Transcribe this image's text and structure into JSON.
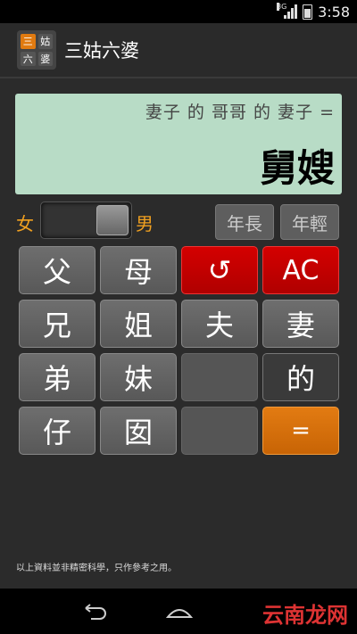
{
  "status_bar": {
    "network": "3G",
    "time": "3:58"
  },
  "app": {
    "title": "三姑六婆",
    "logo": [
      "三",
      "姑",
      "六",
      "婆"
    ]
  },
  "display": {
    "expression": "妻子 的 哥哥 的 妻子 =",
    "result": "舅嫂"
  },
  "gender": {
    "female_label": "女",
    "male_label": "男",
    "selected": "male"
  },
  "age_buttons": {
    "older": "年長",
    "younger": "年輕"
  },
  "keys": {
    "father": "父",
    "mother": "母",
    "undo": "↺",
    "clear": "AC",
    "brother": "兄",
    "sister_older": "姐",
    "husband": "夫",
    "wife": "妻",
    "brother_younger": "弟",
    "sister_younger": "妹",
    "of": "的",
    "son": "仔",
    "daughter": "囡",
    "equals": "="
  },
  "disclaimer": "以上資料並非精密科學，只作參考之用。",
  "nav": {
    "back_icon": "back-icon",
    "home_icon": "home-icon"
  },
  "watermark": "云南龙网",
  "colors": {
    "display_bg": "#b8dcc6",
    "accent": "#f0a020",
    "red": "#d40000",
    "orange": "#e27b12"
  }
}
